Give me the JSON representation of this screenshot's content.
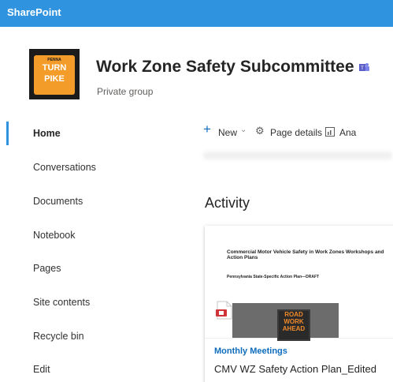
{
  "suite": {
    "brand": "SharePoint"
  },
  "site": {
    "logo": {
      "penn": "PENNA",
      "line1": "TURN",
      "line2": "PIKE"
    },
    "title": "Work Zone Safety Subcommittee",
    "group_type": "Private group"
  },
  "nav": [
    {
      "label": "Home",
      "active": true
    },
    {
      "label": "Conversations"
    },
    {
      "label": "Documents"
    },
    {
      "label": "Notebook"
    },
    {
      "label": "Pages"
    },
    {
      "label": "Site contents"
    },
    {
      "label": "Recycle bin"
    },
    {
      "label": "Edit"
    }
  ],
  "commandbar": {
    "new_label": "New",
    "page_details_label": "Page details",
    "analytics_label": "Ana"
  },
  "activity": {
    "heading": "Activity",
    "card": {
      "thumb_title": "Commercial Motor Vehicle Safety in Work Zones Workshops and Action Plans",
      "thumb_sub": "Pennsylvania State-Specific Action Plan—DRAFT",
      "sign_text": [
        "ROAD",
        "WORK",
        "AHEAD"
      ],
      "site_name": "Monthly Meetings",
      "doc_title": "CMV WZ Safety Action Plan_Edited"
    }
  },
  "colors": {
    "suitebar": "#2f93df",
    "accent": "#2f93df",
    "link": "#0f6cbd"
  }
}
